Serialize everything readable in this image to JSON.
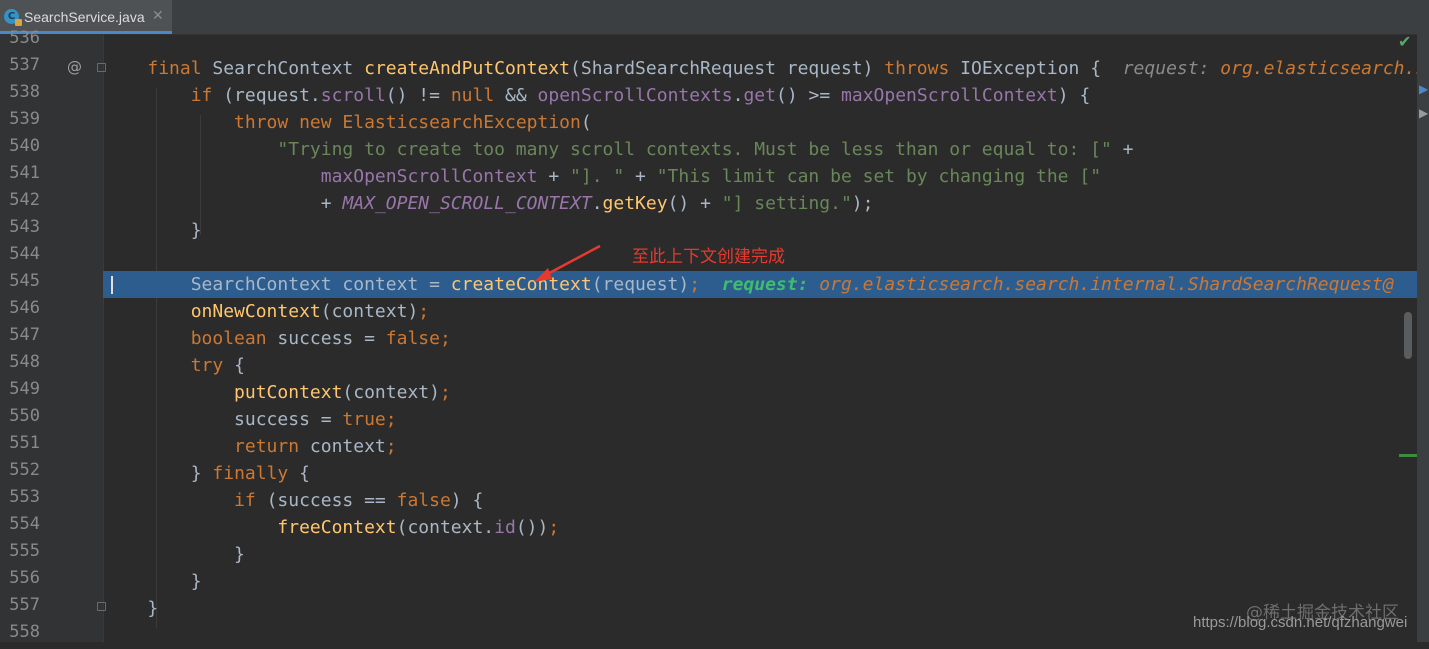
{
  "tab": {
    "icon_letter": "C",
    "label": "SearchService.java",
    "close": "✕"
  },
  "line_numbers": [
    "536",
    "537",
    "538",
    "539",
    "540",
    "541",
    "542",
    "543",
    "544",
    "545",
    "546",
    "547",
    "548",
    "549",
    "550",
    "551",
    "552",
    "553",
    "554",
    "555",
    "556",
    "557",
    "558"
  ],
  "gutter": {
    "override_marker": "@"
  },
  "code": {
    "l537": {
      "final": "final ",
      "type": "SearchContext ",
      "method": "createAndPutContext",
      "params": "(ShardSearchRequest request) ",
      "throws": "throws ",
      "exc": "IOException {",
      "hint_label": "  request: ",
      "hint_value": "org.elasticsearch.search.internal.ShardSearchRequest@"
    },
    "l538": {
      "if": "if ",
      "a": "(request.",
      "b": "scroll",
      "c": "() != ",
      "d": "null",
      "e": " && ",
      "f": "openScrollContexts",
      "g": ".",
      "h": "get",
      "i": "() >= ",
      "j": "maxOpenScrollContext",
      "k": ") {"
    },
    "l539": {
      "throw": "throw new ",
      "exc": "ElasticsearchException",
      "p": "("
    },
    "l540": {
      "s": "\"Trying to create too many scroll contexts. Must be less than or equal to: [\"",
      "p": " +"
    },
    "l541": {
      "a": "maxOpenScrollContext",
      "b": " + ",
      "c": "\"]. \"",
      "d": " + ",
      "e": "\"This limit can be set by changing the [\""
    },
    "l542": {
      "a": "+ ",
      "b": "MAX_OPEN_SCROLL_CONTEXT",
      "c": ".",
      "d": "getKey",
      "e": "() + ",
      "f": "\"] setting.\"",
      "g": ");"
    },
    "l543": {
      "a": "}"
    },
    "l545": {
      "a": "SearchContext context = ",
      "b": "createContext",
      "c": "(request)",
      "d": ";",
      "dbg_label": "  request: ",
      "dbg_value": "org.elasticsearch.search.internal.ShardSearchRequest@"
    },
    "l546": {
      "a": "onNewContext",
      "b": "(context)",
      "c": ";"
    },
    "l547": {
      "a": "boolean ",
      "b": "success = ",
      "c": "false;"
    },
    "l548": {
      "a": "try ",
      "b": "{"
    },
    "l549": {
      "a": "putContext",
      "b": "(context)",
      "c": ";"
    },
    "l550": {
      "a": "success = ",
      "b": "true;"
    },
    "l551": {
      "a": "return ",
      "b": "context",
      "c": ";"
    },
    "l552": {
      "a": "} ",
      "b": "finally ",
      "c": "{"
    },
    "l553": {
      "a": "if ",
      "b": "(success == ",
      "c": "false",
      "d": ") {"
    },
    "l554": {
      "a": "freeContext",
      "b": "(context.",
      "c": "id",
      "d": "())",
      "e": ";"
    },
    "l555": {
      "a": "}"
    },
    "l556": {
      "a": "}"
    },
    "l557": {
      "a": "}"
    }
  },
  "annotation": {
    "text": "至此上下文创建完成",
    "color": "#e53b2f"
  },
  "watermark": {
    "line1": "@稀土掘金技术社区",
    "line2": "https://blog.csdn.net/qfzhangwei"
  },
  "colors": {
    "background": "#2b2b2b",
    "highlight": "#2d5d8f",
    "keyword": "#cc7832",
    "method": "#ffc66d",
    "string": "#6a8759",
    "field": "#9876aa"
  }
}
